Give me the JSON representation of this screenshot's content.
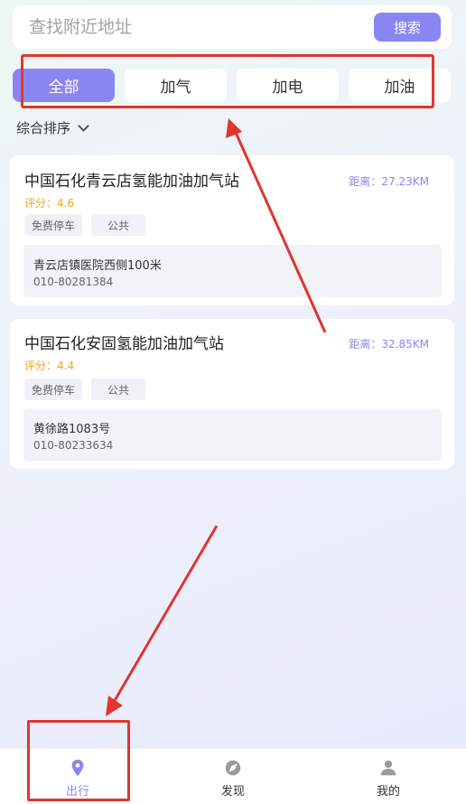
{
  "search": {
    "placeholder": "查找附近地址",
    "button_label": "搜索"
  },
  "tabs": [
    {
      "label": "全部",
      "active": true
    },
    {
      "label": "加气",
      "active": false
    },
    {
      "label": "加电",
      "active": false
    },
    {
      "label": "加油",
      "active": false
    }
  ],
  "sort": {
    "label": "综合排序"
  },
  "stations": [
    {
      "name": "中国石化青云店氢能加油加气站",
      "distance": "距离：27.23KM",
      "rating": "评分：4.6",
      "tags": [
        "免费停车",
        "公共"
      ],
      "address": "青云店镇医院西侧100米",
      "phone": "010-80281384"
    },
    {
      "name": "中国石化安固氢能加油加气站",
      "distance": "距离：32.85KM",
      "rating": "评分：4.4",
      "tags": [
        "免费停车",
        "公共"
      ],
      "address": "黄徐路1083号",
      "phone": "010-80233634"
    }
  ],
  "nav": [
    {
      "label": "出行",
      "icon": "location-pin-icon",
      "active": true
    },
    {
      "label": "发现",
      "icon": "compass-icon",
      "active": false
    },
    {
      "label": "我的",
      "icon": "user-icon",
      "active": false
    }
  ],
  "colors": {
    "accent": "#8a86f1",
    "rating": "#f2a516",
    "annotation": "#e0362f"
  }
}
